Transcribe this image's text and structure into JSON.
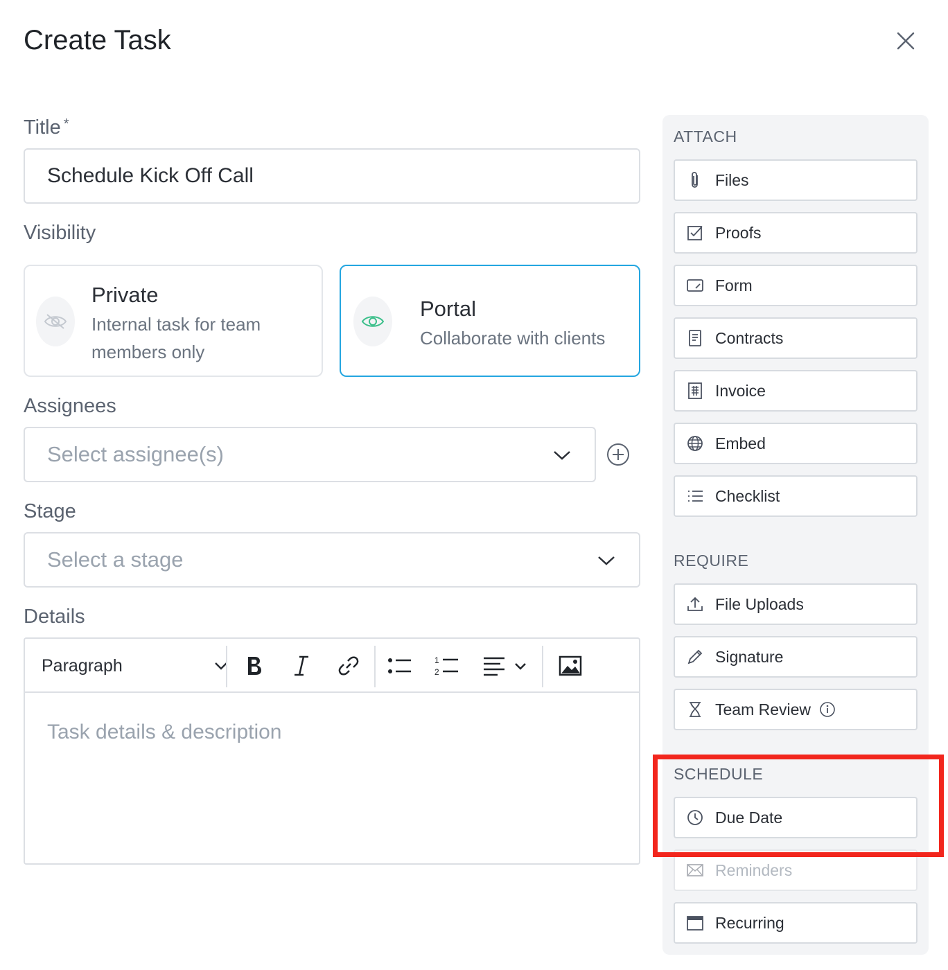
{
  "dialog": {
    "title": "Create Task",
    "close_icon": "close-icon"
  },
  "form": {
    "title_label": "Title",
    "title_required_mark": "*",
    "title_value": "Schedule Kick Off Call",
    "visibility_label": "Visibility",
    "visibility_options": [
      {
        "title": "Private",
        "description": "Internal task for team members only",
        "icon": "eye-off-icon",
        "selected": false
      },
      {
        "title": "Portal",
        "description": "Collaborate with clients",
        "icon": "eye-icon",
        "selected": true
      }
    ],
    "assignees_label": "Assignees",
    "assignees_placeholder": "Select assignee(s)",
    "stage_label": "Stage",
    "stage_placeholder": "Select a stage",
    "details_label": "Details",
    "editor": {
      "block_format": "Paragraph",
      "toolbar_icons": [
        "bold-icon",
        "italic-icon",
        "link-icon",
        "bulleted-list-icon",
        "numbered-list-icon",
        "align-icon",
        "image-icon"
      ],
      "placeholder": "Task details & description"
    }
  },
  "sidebar": {
    "attach": {
      "heading": "ATTACH",
      "items": [
        {
          "label": "Files",
          "icon": "paperclip-icon"
        },
        {
          "label": "Proofs",
          "icon": "checkbox-icon"
        },
        {
          "label": "Form",
          "icon": "form-icon"
        },
        {
          "label": "Contracts",
          "icon": "document-icon"
        },
        {
          "label": "Invoice",
          "icon": "invoice-icon"
        },
        {
          "label": "Embed",
          "icon": "globe-icon"
        },
        {
          "label": "Checklist",
          "icon": "checklist-icon"
        }
      ]
    },
    "require": {
      "heading": "REQUIRE",
      "items": [
        {
          "label": "File Uploads",
          "icon": "upload-icon"
        },
        {
          "label": "Signature",
          "icon": "pen-icon"
        },
        {
          "label": "Team Review",
          "icon": "hourglass-icon"
        }
      ]
    },
    "schedule": {
      "heading": "SCHEDULE",
      "items": [
        {
          "label": "Due Date",
          "icon": "clock-icon",
          "disabled": false
        },
        {
          "label": "Reminders",
          "icon": "mail-icon",
          "disabled": true
        },
        {
          "label": "Recurring",
          "icon": "calendar-icon",
          "disabled": false
        }
      ]
    }
  },
  "annotation": {
    "highlight_color": "#f2261d"
  },
  "colors": {
    "accent": "#24a6e0",
    "portal_icon": "#3bbf8a",
    "panel_bg": "#f3f4f6"
  }
}
